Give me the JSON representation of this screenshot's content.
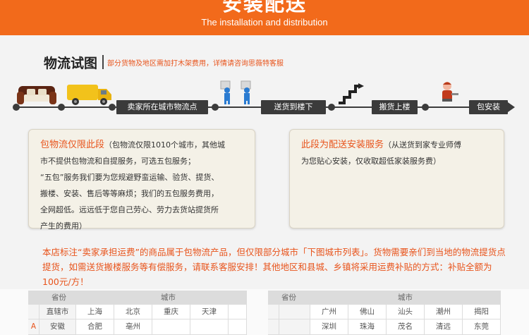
{
  "banner": {
    "title": "安装配送",
    "subtitle": "The installation and distribution"
  },
  "section": {
    "title": "物流试图",
    "note": "部分货物及地区需加打木架费用，详情请咨询思薇特客服"
  },
  "flow": {
    "steps": [
      "卖家所在城市物流点",
      "送货到楼下",
      "搬货上楼",
      "包安装"
    ]
  },
  "icons": [
    "sofa-icon",
    "truck-icon",
    "delivery-workers-icon",
    "stairs-icon",
    "installer-icon"
  ],
  "box_left": {
    "highlight": "包物流仅限此段",
    "line1_rest": "（包物流仅限1010个城市，其他城",
    "line2": "市不提供包物流和自提服务，可选五包服务；",
    "line3": "“五包”服务我们要为您规避野蛮运输、验货、提货、",
    "line4": "搬楼、安装、售后等等麻烦；我们的五包服务费用，",
    "line5": "全网超低。远远低于您自己劳心、劳力去货站提货所",
    "line6": "产生的费用）"
  },
  "box_right": {
    "highlight": "此段为配送安装服务",
    "line1_rest": "（从送货到家专业师傅",
    "line2": "为您贴心安装，仅收取超低家装服务费）"
  },
  "notice": {
    "text": "本店标注“卖家承担运费”的商品属于包物流产品，但仅限部分城市「下图城市列表」。货物需要亲们到当地的物流提货点提货，如需送货搬楼服务等有偿服务，请联系客服安排！其他地区和县城、乡镇将采用运费补贴的方式：补贴全额为100元/方！"
  },
  "table": {
    "left": {
      "headers": [
        "省份",
        "城市"
      ],
      "rows": [
        {
          "letter": "",
          "province": "直辖市",
          "cities": [
            "上海",
            "北京",
            "重庆",
            "天津"
          ]
        },
        {
          "letter": "A",
          "province": "安徽",
          "cities": [
            "合肥",
            "亳州",
            "",
            ""
          ]
        }
      ]
    },
    "right": {
      "headers": [
        "省份",
        "城市"
      ],
      "rows": [
        {
          "letter": "",
          "province": "",
          "cities": [
            "广州",
            "佛山",
            "汕头",
            "潮州",
            "揭阳"
          ]
        },
        {
          "letter": "",
          "province": "",
          "cities": [
            "深圳",
            "珠海",
            "茂名",
            "清远",
            "东莞"
          ]
        }
      ]
    }
  },
  "colors": {
    "accent": "#f26a1b",
    "highlight_text": "#e8541c",
    "flow_dark": "#3b3b3b",
    "box_bg": "#f4f1e7"
  }
}
